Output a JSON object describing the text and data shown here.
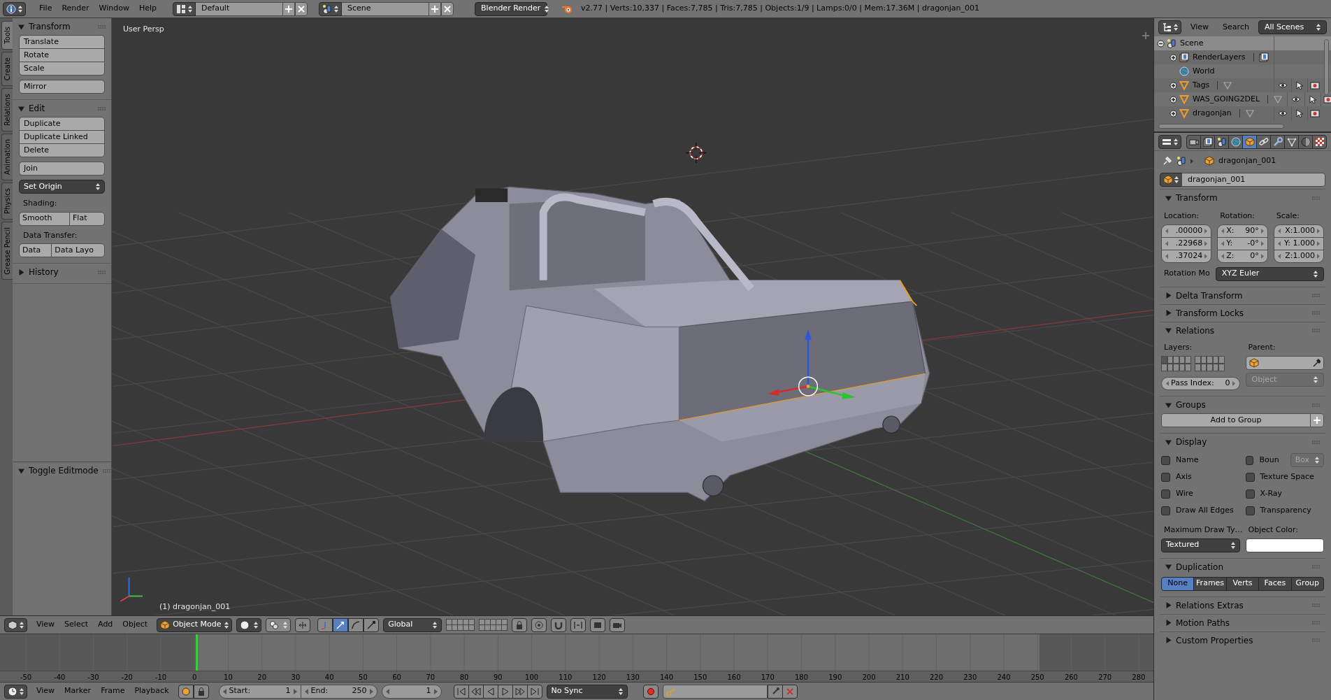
{
  "top_bar": {
    "menus": [
      "File",
      "Render",
      "Window",
      "Help"
    ],
    "screen_layout": "Default",
    "scene": "Scene",
    "render_engine": "Blender Render",
    "stats": "v2.77 | Verts:10,337 | Faces:7,785 | Tris:7,785 | Objects:1/9 | Lamps:0/0 | Mem:17.36M | dragonjan_001"
  },
  "tool_shelf": {
    "tabs": [
      {
        "label": "Tools",
        "selected": true
      },
      {
        "label": "Create",
        "selected": false
      },
      {
        "label": "Relations",
        "selected": false
      },
      {
        "label": "Animation",
        "selected": false
      },
      {
        "label": "Physics",
        "selected": false
      },
      {
        "label": "Grease Pencil",
        "selected": false
      }
    ],
    "panels": [
      {
        "title": "Transform",
        "expanded": true,
        "items": [
          {
            "kind": "stack",
            "buttons": [
              "Translate",
              "Rotate",
              "Scale"
            ]
          },
          {
            "kind": "stack",
            "buttons": [
              "Mirror"
            ]
          }
        ]
      },
      {
        "title": "Edit",
        "expanded": true,
        "items": [
          {
            "kind": "stack",
            "buttons": [
              "Duplicate",
              "Duplicate Linked",
              "Delete"
            ]
          },
          {
            "kind": "stack",
            "buttons": [
              "Join"
            ]
          },
          {
            "kind": "dropdown",
            "label": "Set Origin"
          },
          {
            "kind": "label",
            "text": "Shading:"
          },
          {
            "kind": "row",
            "buttons": [
              "Smooth",
              "Flat"
            ]
          },
          {
            "kind": "label",
            "text": "Data Transfer:"
          },
          {
            "kind": "row",
            "buttons": [
              "Data",
              "Data Layo"
            ]
          }
        ]
      },
      {
        "title": "History",
        "expanded": false
      }
    ],
    "operator_panel": {
      "title": "Toggle Editmode",
      "expanded": true
    }
  },
  "viewport": {
    "view_name": "User Persp",
    "object_info": "(1) dragonjan_001",
    "header": {
      "menus": [
        "View",
        "Select",
        "Add",
        "Object"
      ],
      "mode": "Object Mode",
      "manipulators": [
        {
          "kind": "translate",
          "on": true
        },
        {
          "kind": "rotate",
          "on": false
        },
        {
          "kind": "scale",
          "on": false
        }
      ],
      "orientation": "Global"
    }
  },
  "timeline": {
    "ticks": [
      "-50",
      "-40",
      "-30",
      "-20",
      "-10",
      "0",
      "10",
      "20",
      "30",
      "40",
      "50",
      "60",
      "70",
      "80",
      "90",
      "100",
      "110",
      "120",
      "130",
      "140",
      "150",
      "160",
      "170",
      "180",
      "190",
      "200",
      "210",
      "220",
      "230",
      "240",
      "250",
      "260",
      "270",
      "280"
    ],
    "header": {
      "menus": [
        "View",
        "Marker",
        "Frame",
        "Playback"
      ],
      "start_label": "Start:",
      "start": "1",
      "end_label": "End:",
      "end": "250",
      "current_frame": "1",
      "sync": "No Sync"
    }
  },
  "outliner": {
    "menus": [
      "View",
      "Search"
    ],
    "display_mode": "All Scenes",
    "tree": [
      {
        "name": "Scene",
        "kind": "scene",
        "expanded": true,
        "selected": true,
        "children": [
          {
            "name": "RenderLayers",
            "kind": "render_layers",
            "expanded": false,
            "selected": false
          },
          {
            "name": "World",
            "kind": "world",
            "selected": false
          },
          {
            "name": "Tags",
            "kind": "object",
            "expanded": false,
            "selected": false,
            "visible": true
          },
          {
            "name": "WAS_GOING2DEL",
            "kind": "object",
            "expanded": false,
            "selected": false,
            "visible": true
          },
          {
            "name": "dragonjan",
            "kind": "object",
            "expanded": false,
            "selected": false,
            "visible": true
          }
        ]
      }
    ]
  },
  "properties": {
    "tabs": [
      {
        "kind": "render",
        "selected": false
      },
      {
        "kind": "render_layers",
        "selected": false
      },
      {
        "kind": "scene",
        "selected": false
      },
      {
        "kind": "world",
        "selected": false
      },
      {
        "kind": "object",
        "selected": true
      },
      {
        "kind": "constraints",
        "selected": false
      },
      {
        "kind": "modifiers",
        "selected": false
      },
      {
        "kind": "data",
        "selected": false
      },
      {
        "kind": "material",
        "selected": false
      },
      {
        "kind": "texture",
        "selected": false
      }
    ],
    "breadcrumb": "dragonjan_001",
    "object_name": "dragonjan_001",
    "panels": [
      {
        "kind": "transform",
        "title": "Transform",
        "expanded": true,
        "location_label": "Location:",
        "rotation_label": "Rotation:",
        "scale_label": "Scale:",
        "location": [
          ".00000",
          ".22968",
          ".37024"
        ],
        "rotation": [
          {
            "axis": "X:",
            "value": "90°"
          },
          {
            "axis": "Y:",
            "value": "-0°"
          },
          {
            "axis": "Z:",
            "value": "0°"
          }
        ],
        "scale": [
          "X:1.000",
          "Y: 1.000",
          "Z:1.000"
        ],
        "rotation_mode_label": "Rotation Mo",
        "rotation_mode": "XYZ Euler"
      },
      {
        "title": "Delta Transform",
        "expanded": false
      },
      {
        "title": "Transform Locks",
        "expanded": false
      },
      {
        "kind": "relations",
        "title": "Relations",
        "expanded": true,
        "layers_label": "Layers:",
        "layers": [
          true,
          false,
          false,
          false,
          false,
          false,
          false,
          false,
          false,
          false,
          false,
          false,
          false,
          false,
          false,
          false,
          false,
          false,
          false,
          false
        ],
        "parent_label": "Parent:",
        "parent_type": {
          "label": "Object",
          "disabled": true
        },
        "pass_index_label": "Pass Index:",
        "pass_index": "0"
      },
      {
        "kind": "groups",
        "title": "Groups",
        "expanded": true,
        "button": "Add to Group"
      },
      {
        "kind": "display",
        "title": "Display",
        "expanded": true,
        "options": [
          {
            "label": "Name",
            "checked": false
          },
          {
            "label": "Boun",
            "checked": false,
            "dropdown": {
              "label": "Box",
              "disabled": true
            }
          },
          {
            "label": "Axis",
            "checked": false
          },
          {
            "label": "Texture Space",
            "checked": false
          },
          {
            "label": "Wire",
            "checked": false
          },
          {
            "label": "X-Ray",
            "checked": false
          },
          {
            "label": "Draw All Edges",
            "checked": false
          },
          {
            "label": "Transparency",
            "checked": false
          }
        ],
        "max_draw_type_label": "Maximum Draw Ty…",
        "max_draw_type": "Textured",
        "object_color_label": "Object Color:"
      },
      {
        "kind": "duplication",
        "title": "Duplication",
        "expanded": true,
        "options": [
          {
            "label": "None",
            "selected": true
          },
          {
            "label": "Frames",
            "selected": false
          },
          {
            "label": "Verts",
            "selected": false
          },
          {
            "label": "Faces",
            "selected": false
          },
          {
            "label": "Group",
            "selected": false
          }
        ]
      },
      {
        "title": "Relations Extras",
        "expanded": false
      },
      {
        "title": "Motion Paths",
        "expanded": false
      },
      {
        "title": "Custom Properties",
        "expanded": false
      }
    ]
  }
}
